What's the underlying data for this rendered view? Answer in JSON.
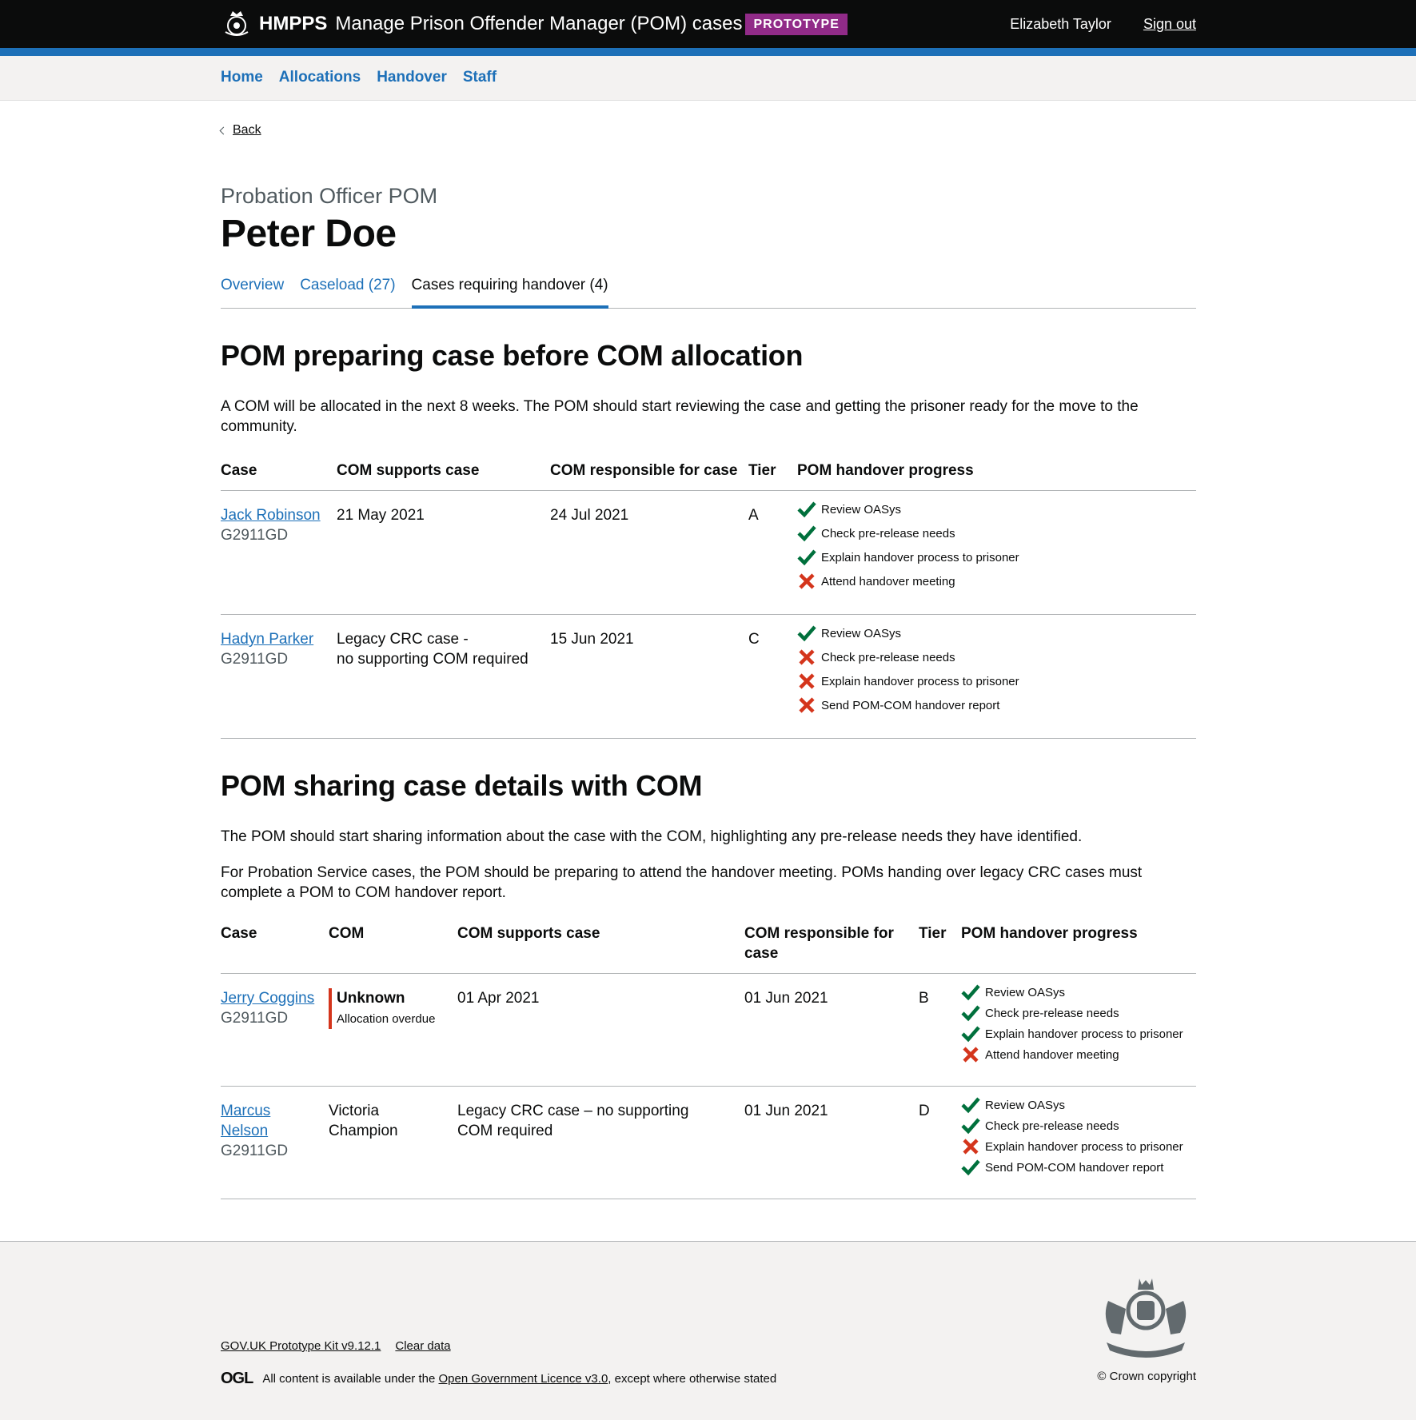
{
  "header": {
    "brand": "HMPPS",
    "service": "Manage Prison Offender Manager (POM) cases",
    "tag": "PROTOTYPE",
    "user": "Elizabeth Taylor",
    "signout": "Sign out"
  },
  "nav": [
    "Home",
    "Allocations",
    "Handover",
    "Staff"
  ],
  "back": "Back",
  "caption": "Probation Officer POM",
  "title": "Peter Doe",
  "tabs": [
    "Overview",
    "Caseload (27)",
    "Cases requiring handover (4)"
  ],
  "section1": {
    "heading": "POM preparing case before COM allocation",
    "intro": "A COM will be allocated in the next 8 weeks. The POM should start reviewing the case and getting the prisoner ready for the move to the community.",
    "headers": [
      "Case",
      "COM supports case",
      "COM responsible for case",
      "Tier",
      "POM handover progress"
    ],
    "rows": [
      {
        "name": "Jack Robinson",
        "id": "G2911GD",
        "supports": "21 May 2021",
        "responsible": "24 Jul 2021",
        "tier": "A",
        "progress": [
          {
            "label": "Review OASys",
            "done": true
          },
          {
            "label": "Check pre-release needs",
            "done": true
          },
          {
            "label": "Explain handover process to prisoner",
            "done": true
          },
          {
            "label": "Attend handover meeting",
            "done": false
          }
        ]
      },
      {
        "name": "Hadyn Parker",
        "id": "G2911GD",
        "supports": "Legacy CRC case -",
        "supports2": "no supporting COM required",
        "responsible": "15 Jun 2021",
        "tier": "C",
        "progress": [
          {
            "label": "Review OASys",
            "done": true
          },
          {
            "label": "Check pre-release needs",
            "done": false
          },
          {
            "label": "Explain handover process to prisoner",
            "done": false
          },
          {
            "label": "Send POM-COM handover report",
            "done": false
          }
        ]
      }
    ]
  },
  "section2": {
    "heading": "POM sharing case details with COM",
    "intro1": "The POM should start sharing information about the case with the COM, highlighting any pre-release needs they have identified.",
    "intro2": "For Probation Service cases, the POM should be preparing to attend the handover meeting. POMs handing over legacy CRC cases must complete a POM to COM handover report.",
    "headers": [
      "Case",
      "COM",
      "COM supports case",
      "COM responsible for case",
      "Tier",
      "POM handover progress"
    ],
    "rows": [
      {
        "name": "Jerry Coggins",
        "id": "G2911GD",
        "com": "Unknown",
        "com_sub": "Allocation overdue",
        "supports": "01 Apr 2021",
        "responsible": "01 Jun 2021",
        "tier": "B",
        "progress": [
          {
            "label": "Review OASys",
            "done": true
          },
          {
            "label": "Check pre-release needs",
            "done": true
          },
          {
            "label": "Explain handover process to prisoner",
            "done": true
          },
          {
            "label": "Attend handover meeting",
            "done": false
          }
        ]
      },
      {
        "name": "Marcus Nelson",
        "id": "G2911GD",
        "com": "Victoria Champion",
        "supports": "Legacy CRC case – no supporting COM required",
        "responsible": "01 Jun 2021",
        "tier": "D",
        "progress": [
          {
            "label": "Review OASys",
            "done": true
          },
          {
            "label": "Check pre-release needs",
            "done": true
          },
          {
            "label": "Explain handover process to prisoner",
            "done": false
          },
          {
            "label": "Send POM-COM handover report",
            "done": true
          }
        ]
      }
    ]
  },
  "footer": {
    "kit": "GOV.UK Prototype Kit v9.12.1",
    "clear": "Clear data",
    "ogl": "OGL",
    "licence_pre": "All content is available under the",
    "licence_link": "Open Government Licence v3.0",
    "licence_post": ", except where otherwise stated",
    "copyright": "© Crown copyright"
  },
  "colors": {
    "link": "#1d70b8",
    "tick": "#00703c",
    "cross": "#d4351c",
    "tag": "#912b88"
  }
}
